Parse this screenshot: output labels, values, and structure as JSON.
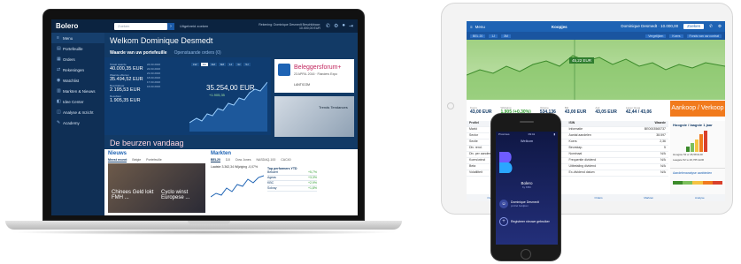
{
  "laptop": {
    "logo": "Bolero",
    "search_placeholder": "Zoeken",
    "search_go": "›",
    "advanced_search": "Uitgebreid zoeken",
    "account": "Rekening: Dominique Desmedt  Beschikbaar: 10.000,00 EUR",
    "sidebar": [
      {
        "icon": "≡",
        "label": "Menu"
      },
      {
        "icon": "▤",
        "label": "Portefeuille"
      },
      {
        "icon": "▦",
        "label": "Orders"
      },
      {
        "icon": "⇄",
        "label": "Rekeningen"
      },
      {
        "icon": "◉",
        "label": "Watchlist"
      },
      {
        "icon": "▥",
        "label": "Markten & Nieuws"
      },
      {
        "icon": "◧",
        "label": "Idee Center"
      },
      {
        "icon": "◫",
        "label": "Analyse & Inzicht"
      },
      {
        "icon": "✎",
        "label": "Academy"
      }
    ],
    "welcome": "Welkom Dominique Desmedt",
    "tabs": [
      "Waarde van uw portefeuille",
      "Openstaande orders (0)"
    ],
    "stats": [
      {
        "label": "Totaal waarde",
        "value": "40.000,35 EUR"
      },
      {
        "label": "Waarde effecten",
        "value": "35.494,52 EUR"
      },
      {
        "label": "Beschikbaar",
        "value": "2.195,53 EUR"
      },
      {
        "label": "Resultaat",
        "value": "1.905,35 EUR"
      }
    ],
    "dates": [
      "24.03.2016",
      "22.03.2016",
      "21.03.2016",
      "18.03.2016",
      "17.03.2016",
      "16.03.2016"
    ],
    "range_buttons": [
      "1W",
      "1M",
      "3M",
      "6M",
      "1J",
      "3J",
      "5J"
    ],
    "range_selected": "1M",
    "portfolio_value": "35.254,00 EUR",
    "portfolio_sub": "+1.905,35",
    "ad1_title": "Beleggersforum+",
    "ad1_sub": "23 APRIL 2016 · Flanders Expo",
    "ad1_footer": "LANTICOM",
    "ad2_text": "Trends Tendances",
    "section_title": "De beurzen vandaag",
    "news_title": "Nieuws",
    "news_tabs": [
      "Meest recent",
      "Belgie",
      "Portefeuille"
    ],
    "news_caption_1": "Chinees Geld lokt FMH ...",
    "news_caption_2": "Cyclo winst Europese ...",
    "markets_title": "Markten",
    "markets_tabs": [
      "BEL20",
      "DJI",
      "Dow Jones",
      "NASDAQ-100",
      "CAC40"
    ],
    "markets_line": "Laatste 3.362,34  Wijziging -0,07%",
    "top_title": "Top performers YTD",
    "top_rows": [
      {
        "name": "Bekaert",
        "pct": "+5,7%"
      },
      {
        "name": "Ageas",
        "pct": "+3,3%"
      },
      {
        "name": "KBC",
        "pct": "+2,9%"
      },
      {
        "name": "Solvay",
        "pct": "+1,8%"
      }
    ]
  },
  "tablet": {
    "menu": "Menu",
    "title": "Koopjes",
    "account": "Dominique Desmedt · 10.000,00",
    "search": "Zoeken",
    "toolbar": [
      "BEL 20",
      "1J",
      "3M",
      "Vergelijken",
      "Koers",
      "Fonds van uw contrat"
    ],
    "chart_badge": "45,22 EUR",
    "quote": [
      {
        "label": "Koers",
        "value": "43,00 EUR"
      },
      {
        "label": "Wijziging",
        "value": "1,905 (+0,30%)",
        "up": true
      },
      {
        "label": "Volume",
        "value": "534.136"
      },
      {
        "label": "Bid",
        "value": "43,00 EUR"
      },
      {
        "label": "Ask",
        "value": "43,05 EUR"
      },
      {
        "label": "Laag / Hoog",
        "value": "42,44 / 43,06"
      }
    ],
    "buy_sell": "Aankoop / Verkoop",
    "table_header": [
      "Profiel",
      "Koers",
      "ISIN",
      "Waarde"
    ],
    "table_rows": [
      [
        "Markt",
        "Euronext Brussel",
        "Informatie",
        "BE0003565737"
      ],
      [
        "Sector",
        "Financiële dienstverlening",
        "Aantal aandelen",
        "38.597"
      ],
      [
        "Sectie",
        "Bankwezen",
        "Koers",
        "2,36"
      ],
      [
        "Div. rend.",
        "3,73%",
        "Beurskap.",
        "5"
      ],
      [
        "Div. per aandeel",
        "1,00",
        "Nominaal",
        "N/A"
      ],
      [
        "Koers/winst",
        "11,04",
        "Frequentie dividend",
        "N/A"
      ],
      [
        "Beta",
        "1,40",
        "Uitbetaling dividend",
        "N/A"
      ],
      [
        "Volatiliteit",
        "19,6%",
        "Ex-dividend datum",
        "N/A"
      ]
    ],
    "side_title": "Hoogste / laagste 1 jaar",
    "side_values": [
      "Hoogste 52 w 45,58 EUR",
      "Laagste 52 w 26,765 EUR"
    ],
    "side_link": "Aandelenanalyse aanbieden",
    "nav": [
      "Overzicht",
      "Portefeuille",
      "Orders",
      "Markten",
      "Analyse"
    ]
  },
  "phone": {
    "carrier": "Proximus",
    "time": "09:41",
    "welkom": "Welkom",
    "brand": "Bolero",
    "brand_sub": "by KBC",
    "user_name": "Dominique Desmedt",
    "user_sub": "profiel bekijken",
    "add_label": "Registreer nieuwe gebruiker"
  },
  "colors": {
    "bolero_navy": "#0e2a48",
    "bolero_blue": "#1e63b4",
    "orange": "#f17a1d",
    "green_area": "#9fd082"
  }
}
